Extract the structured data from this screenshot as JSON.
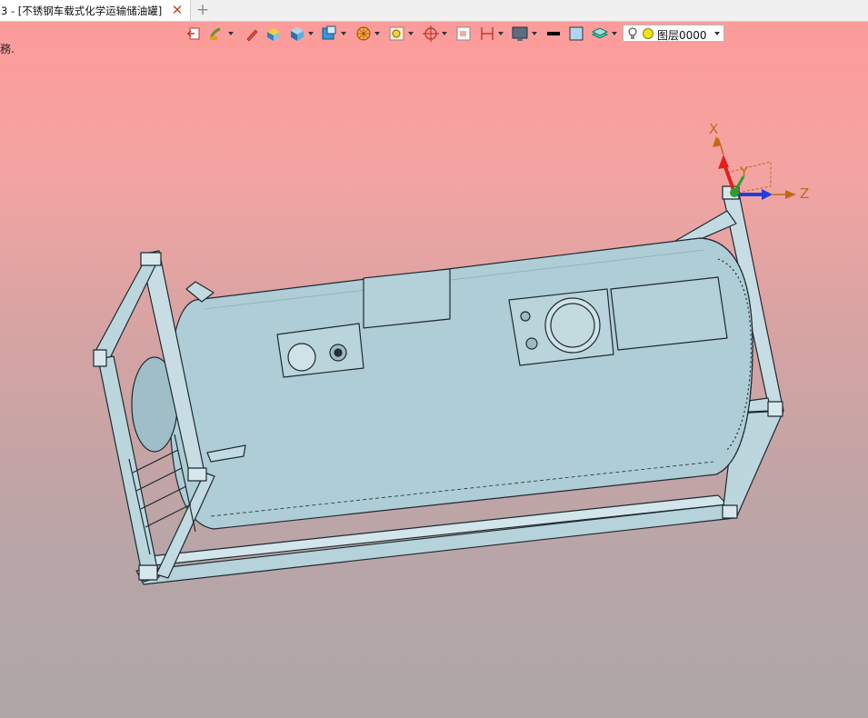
{
  "tab": {
    "title": "3 - [不锈钢车载式化学运输储油罐]",
    "close_glyph": "✕",
    "add_glyph": "+"
  },
  "status_fragment": "務.",
  "toolbar": {
    "icons": [
      "exit-sketch-icon",
      "paint-brush-icon",
      "pencil-icon",
      "shaded-box-icon",
      "cube-icon",
      "view-cube-icon",
      "render-ball-icon",
      "zoom-window-icon",
      "rotate-view-icon",
      "frame-icon",
      "dimension-icon",
      "display-monitor-icon",
      "line-color-icon",
      "fill-color-icon",
      "layers-icon"
    ],
    "layer_select": {
      "value": "图层0000"
    }
  },
  "triad": {
    "x_label": "X",
    "y_label": "Y",
    "z_label": "Z"
  },
  "colors": {
    "accent_axis": "#c16a14",
    "model_fill": "#aecdd6",
    "model_edge": "#1e2a30"
  }
}
